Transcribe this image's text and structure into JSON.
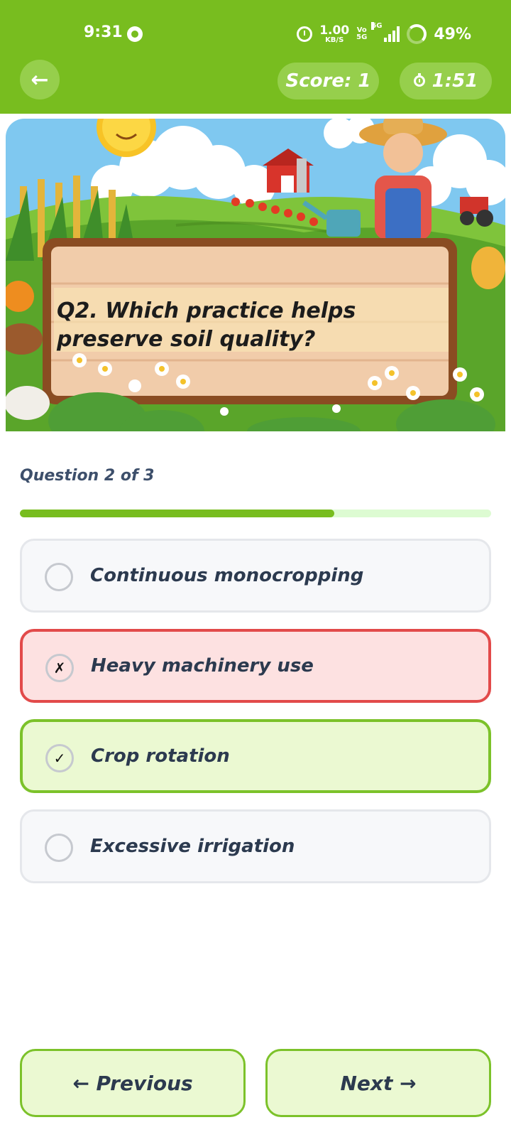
{
  "status_bar": {
    "time": "9:31",
    "net_speed_value": "1.00",
    "net_speed_unit": "KB/S",
    "volte_top": "Vo",
    "volte_bottom": "5G",
    "signal_tag": "5G",
    "battery": "49%"
  },
  "header": {
    "back_icon": "←",
    "score": "Score: 1",
    "timer": "1:51"
  },
  "question": {
    "text": "Q2. Which practice helps preserve soil quality?"
  },
  "progress": {
    "label": "Question 2 of 3",
    "fraction": 0.667
  },
  "options": [
    {
      "label": "Continuous monocropping",
      "state": "neutral",
      "mark": ""
    },
    {
      "label": "Heavy machinery use",
      "state": "wrong",
      "mark": "✗"
    },
    {
      "label": "Crop rotation",
      "state": "correct",
      "mark": "✓"
    },
    {
      "label": "Excessive irrigation",
      "state": "neutral",
      "mark": ""
    }
  ],
  "nav": {
    "previous": "← Previous",
    "next": "Next →"
  },
  "colors": {
    "header_green": "#78bd1f",
    "wrong_red": "#e24a4a",
    "correct_green": "#7cc22a"
  }
}
